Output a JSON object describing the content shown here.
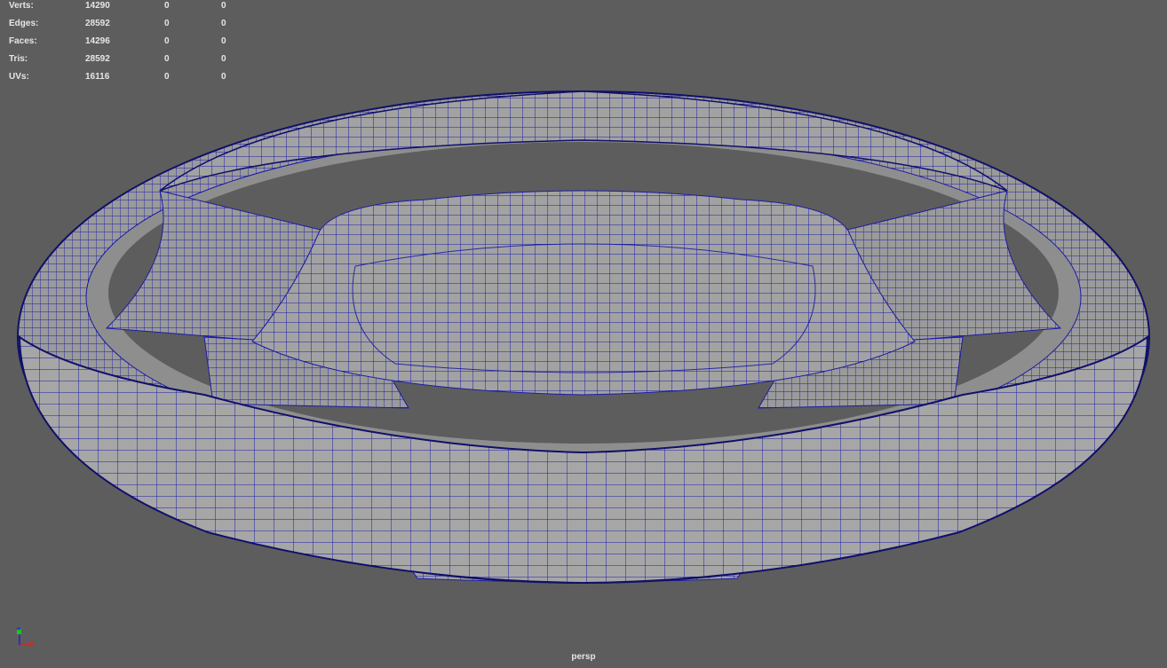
{
  "hud": {
    "rows": [
      {
        "label": "Verts:",
        "total": "14290",
        "selected": "0",
        "component": "0"
      },
      {
        "label": "Edges:",
        "total": "28592",
        "selected": "0",
        "component": "0"
      },
      {
        "label": "Faces:",
        "total": "14296",
        "selected": "0",
        "component": "0"
      },
      {
        "label": "Tris:",
        "total": "28592",
        "selected": "0",
        "component": "0"
      },
      {
        "label": "UVs:",
        "total": "16116",
        "selected": "0",
        "component": "0"
      }
    ]
  },
  "camera_label": "persp",
  "colors": {
    "background": "#5d5d5d",
    "mesh": "#a0a0a0",
    "wire": "#1c1ca8"
  },
  "axis_icons": [
    "x-axis-icon",
    "y-axis-icon",
    "z-axis-icon"
  ]
}
